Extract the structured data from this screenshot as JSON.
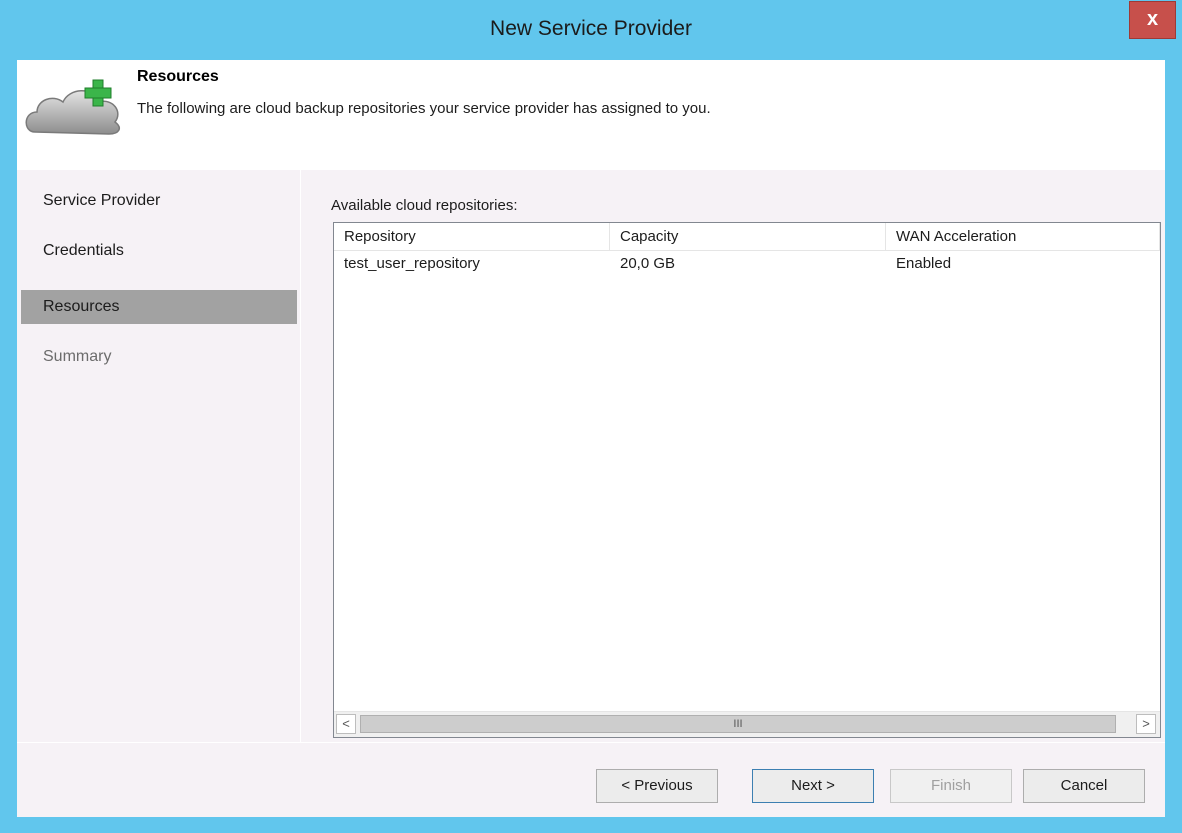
{
  "window": {
    "title": "New Service Provider",
    "close_label": "x"
  },
  "header": {
    "title": "Resources",
    "description": "The following are cloud backup repositories your service provider has assigned to you.",
    "icon": "cloud-add-icon"
  },
  "nav": {
    "items": [
      {
        "label": "Service Provider",
        "state": "normal"
      },
      {
        "label": "Credentials",
        "state": "normal"
      },
      {
        "label": "Resources",
        "state": "active"
      },
      {
        "label": "Summary",
        "state": "disabled"
      }
    ]
  },
  "content": {
    "list_label": "Available cloud repositories:",
    "columns": [
      "Repository",
      "Capacity",
      "WAN Acceleration"
    ],
    "rows": [
      [
        "test_user_repository",
        "20,0 GB",
        "Enabled"
      ]
    ],
    "scroll": {
      "left_arrow": "<",
      "right_arrow": ">",
      "thumb_grip": "III"
    }
  },
  "footer": {
    "previous_label": "< Previous",
    "next_label": "Next >",
    "finish_label": "Finish",
    "cancel_label": "Cancel"
  },
  "colors": {
    "titlebar": "#61c6ed",
    "close_button": "#c7504b",
    "panel_background": "#f6f2f6",
    "nav_active": "#a2a2a2"
  }
}
